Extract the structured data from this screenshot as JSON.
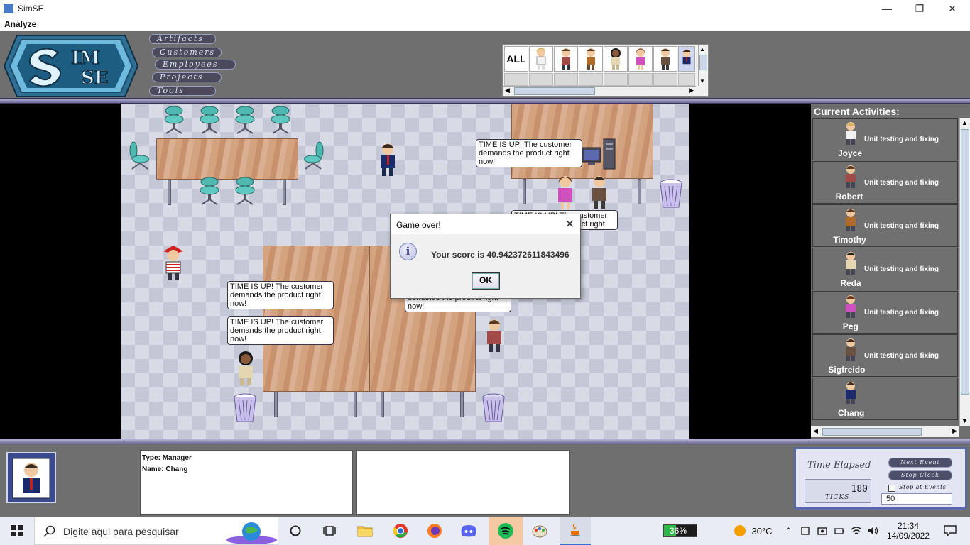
{
  "window": {
    "title": "SimSE",
    "menu": "Analyze"
  },
  "header": {
    "logo_text": "SimSE",
    "nav": [
      "Artifacts",
      "Customers",
      "Employees",
      "Projects",
      "Tools"
    ],
    "employee_filter_all": "ALL"
  },
  "bubbles": {
    "text_line1": "TIME IS UP! The customer",
    "text_line2": "demands the product right",
    "text_line3": "now!",
    "partial_line1": "TIME IS UP! The customer",
    "partial_line2": "demands the product right"
  },
  "dialog": {
    "title": "Game over!",
    "message": "Your score is 40.942372611843496",
    "ok": "OK"
  },
  "activities": {
    "title": "Current Activities:",
    "items": [
      {
        "name": "Joyce",
        "task": "Unit testing and fixing",
        "shirt": "#f1f1f1",
        "hair": "#d8b660"
      },
      {
        "name": "Robert",
        "task": "Unit testing and fixing",
        "shirt": "#a24a4a",
        "hair": "#5a3a20"
      },
      {
        "name": "Timothy",
        "task": "Unit testing and fixing",
        "shirt": "#b06a2a",
        "hair": "#5a3a20"
      },
      {
        "name": "Reda",
        "task": "Unit testing and fixing",
        "shirt": "#e4d6b0",
        "hair": "#1a1a1a"
      },
      {
        "name": "Peg",
        "task": "Unit testing and fixing",
        "shirt": "#d050c0",
        "hair": "#6a3a20"
      },
      {
        "name": "Sigfreido",
        "task": "Unit testing and fixing",
        "shirt": "#6a5040",
        "hair": "#3a2a20"
      },
      {
        "name": "Chang",
        "task": "",
        "shirt": "#1a2a6a",
        "hair": "#3a2a20"
      }
    ]
  },
  "selected_employee": {
    "type_label": "Type: Manager",
    "name_label": "Name: Chang"
  },
  "clock": {
    "title": "Time Elapsed",
    "ticks_value": "180",
    "ticks_label": "TICKS",
    "next_event": "Next Event",
    "stop_clock": "Stop Clock",
    "stop_at_events": "Stop at Events",
    "stop_at_events_checked": false,
    "steps_value": "50"
  },
  "taskbar": {
    "search_placeholder": "Digite aqui para pesquisar",
    "battery": "36%",
    "weather": "30°C",
    "time": "21:34",
    "date": "14/09/2022"
  },
  "colors": {
    "accent": "#5a6aa8",
    "background": "#6f6f6f"
  }
}
